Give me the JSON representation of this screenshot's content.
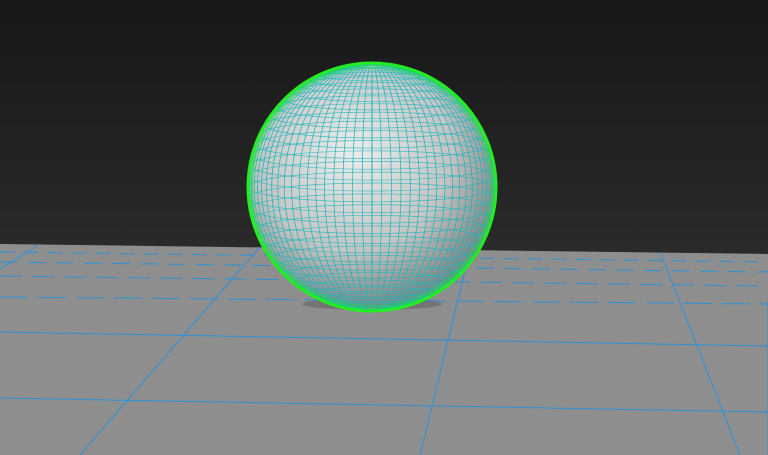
{
  "viewport": {
    "colors": {
      "background_top": "#171717",
      "background_bottom": "#3a3a3a",
      "ground_plane": "#8e8e8e",
      "ground_grid": "#2b93d6",
      "sphere_surface_light": "#ececec",
      "sphere_surface_dark": "#6a6a6a",
      "sphere_wireframe": "#1fb6ba",
      "selection_outline": "#22ee22"
    },
    "scene": {
      "object": "sphere",
      "display_mode": "shaded-with-wireframe",
      "selected": true,
      "ground_grid_visible": true
    }
  }
}
